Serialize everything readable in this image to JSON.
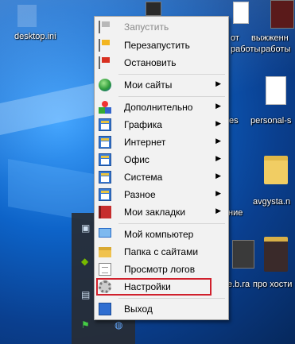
{
  "desktop": {
    "icons": [
      {
        "label": "desktop.ini"
      },
      {
        "label": "от"
      },
      {
        "label": "работы"
      },
      {
        "label": "выжженн"
      },
      {
        "label": "работы"
      },
      {
        "label": "es"
      },
      {
        "label": "personal-s"
      },
      {
        "label": "avgysta.n"
      },
      {
        "label": "ние"
      },
      {
        "label": "e.b.ra"
      },
      {
        "label": "про хости"
      }
    ]
  },
  "menu": {
    "items": [
      {
        "label": "Запустить",
        "icon": "flag-gray-icon",
        "disabled": true
      },
      {
        "label": "Перезапустить",
        "icon": "flag-yellow-icon"
      },
      {
        "label": "Остановить",
        "icon": "flag-red-icon"
      },
      {
        "label": "Мои сайты",
        "icon": "globe-icon",
        "submenu": true
      },
      {
        "label": "Дополнительно",
        "icon": "shapes-icon",
        "submenu": true
      },
      {
        "label": "Графика",
        "icon": "window-icon",
        "submenu": true
      },
      {
        "label": "Интернет",
        "icon": "window-icon",
        "submenu": true
      },
      {
        "label": "Офис",
        "icon": "window-icon",
        "submenu": true
      },
      {
        "label": "Система",
        "icon": "window-icon",
        "submenu": true
      },
      {
        "label": "Разное",
        "icon": "window-icon",
        "submenu": true
      },
      {
        "label": "Мои закладки",
        "icon": "book-icon",
        "submenu": true
      },
      {
        "label": "Мой компьютер",
        "icon": "computer-icon"
      },
      {
        "label": "Папка с сайтами",
        "icon": "folder-icon"
      },
      {
        "label": "Просмотр логов",
        "icon": "document-icon"
      },
      {
        "label": "Настройки",
        "icon": "gear-icon",
        "highlighted": true
      },
      {
        "label": "Выход",
        "icon": "exit-icon"
      }
    ],
    "submenu_arrow": "▶",
    "highlight_color": "#d0202c"
  }
}
